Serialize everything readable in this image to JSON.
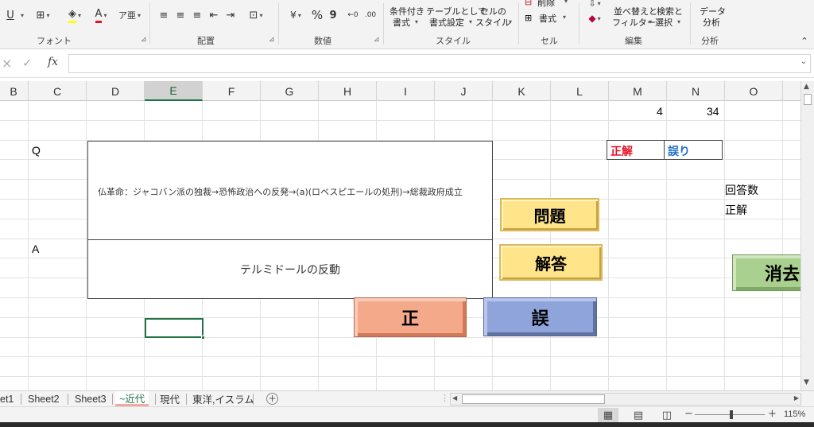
{
  "ribbon": {
    "font_group_label": "フォント",
    "align_group_label": "配置",
    "number_group_label": "数値",
    "styles_group_label": "スタイル",
    "cells_group_label": "セル",
    "edit_group_label": "編集",
    "analysis_group_label": "分析",
    "percent_symbol": "%",
    "comma_symbol": "9",
    "cond_format_line1": "条件付き",
    "cond_format_line2": "書式",
    "format_table_line1": "テーブルとして",
    "format_table_line2": "書式設定",
    "cell_style_line1": "セルの",
    "cell_style_line2": "スタイル",
    "delete_label": "削除",
    "format_label": "書式",
    "sort_line1": "並べ替えと",
    "sort_line2": "フィルター",
    "find_line1": "検索と",
    "find_line2": "選択",
    "data_analysis_line1": "データ",
    "data_analysis_line2": "分析",
    "underline_glyph": "U",
    "font_color_glyph": "A"
  },
  "formula_bar": {
    "fx_label": "fx",
    "cancel_glyph": "×",
    "enter_glyph": "✓",
    "formula_value": ""
  },
  "columns": [
    "B",
    "C",
    "D",
    "E",
    "F",
    "G",
    "H",
    "I",
    "J",
    "K",
    "L",
    "M",
    "N",
    "O"
  ],
  "cells": {
    "m1": "4",
    "n1": "34",
    "c_q": "Q",
    "c_a": "A",
    "m_correct_header": "正解",
    "n_wrong_header": "誤り",
    "o_answers_label": "回答数",
    "o_correct_label": "正解"
  },
  "question_box": {
    "text": "仏革命：ジャコバン派の独裁→恐怖政治への反発→(a)(ロベスピエールの処刑)→総裁政府成立"
  },
  "answer_box": {
    "text": "テルミドールの反動"
  },
  "buttons": {
    "question": "問題",
    "answer": "解答",
    "correct": "正",
    "wrong": "誤",
    "clear": "消去"
  },
  "colors": {
    "header_red": "#e81123",
    "header_blue": "#1f6fc5",
    "yellow_btn": "#ffe48a",
    "orange_btn": "#f4a98a",
    "blue_btn": "#8fa4db",
    "green_btn": "#a9d08e"
  },
  "sheet_tabs": [
    {
      "label": "et1"
    },
    {
      "label": "Sheet2"
    },
    {
      "label": "Sheet3"
    },
    {
      "label": "~近代"
    },
    {
      "label": "現代"
    },
    {
      "label": "東洋,イスラム"
    }
  ],
  "status": {
    "zoom": "115%"
  }
}
